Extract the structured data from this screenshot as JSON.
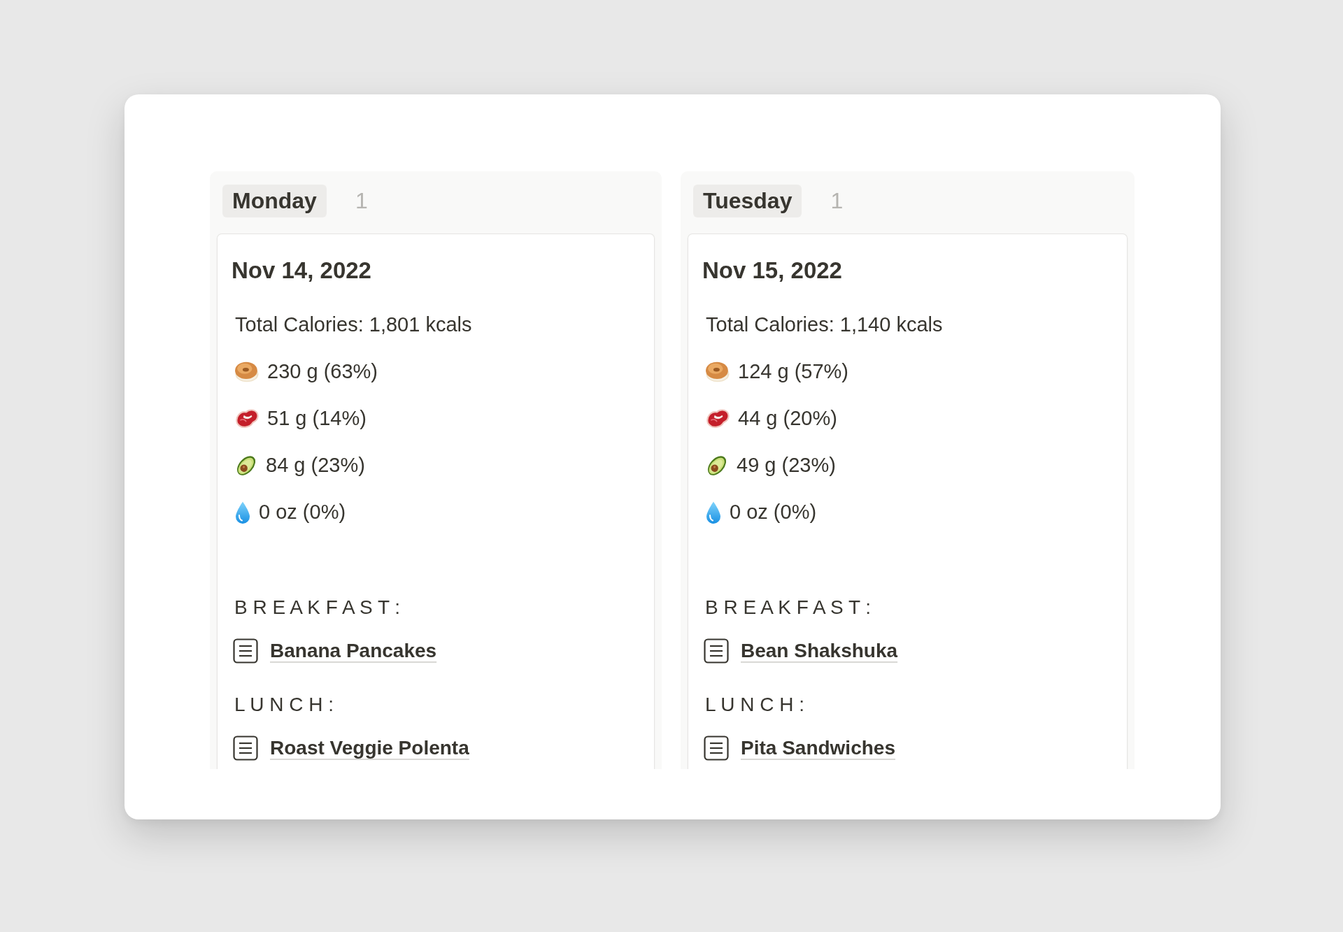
{
  "board": {
    "columns": [
      {
        "label": "Monday",
        "count": "1",
        "cards": [
          {
            "title": "Nov 14, 2022",
            "total_calories": "Total Calories: 1,801 kcals",
            "macros": [
              {
                "kind": "carbs",
                "value": "230 g (63%)"
              },
              {
                "kind": "protein",
                "value": "51 g (14%)"
              },
              {
                "kind": "fat",
                "value": "84 g (23%)"
              },
              {
                "kind": "water",
                "value": "0 oz (0%)"
              }
            ],
            "meals": [
              {
                "heading": "B R E A K F A S T :",
                "recipe": "Banana Pancakes"
              },
              {
                "heading": "L U N C H :",
                "recipe": "Roast Veggie Polenta"
              }
            ]
          }
        ]
      },
      {
        "label": "Tuesday",
        "count": "1",
        "cards": [
          {
            "title": "Nov 15, 2022",
            "total_calories": "Total Calories: 1,140 kcals",
            "macros": [
              {
                "kind": "carbs",
                "value": "124 g (57%)"
              },
              {
                "kind": "protein",
                "value": "44 g (20%)"
              },
              {
                "kind": "fat",
                "value": "49 g (23%)"
              },
              {
                "kind": "water",
                "value": "0 oz (0%)"
              }
            ],
            "meals": [
              {
                "heading": "B R E A K F A S T :",
                "recipe": "Bean Shakshuka"
              },
              {
                "heading": "L U N C H :",
                "recipe": "Pita Sandwiches"
              }
            ]
          }
        ]
      }
    ]
  }
}
